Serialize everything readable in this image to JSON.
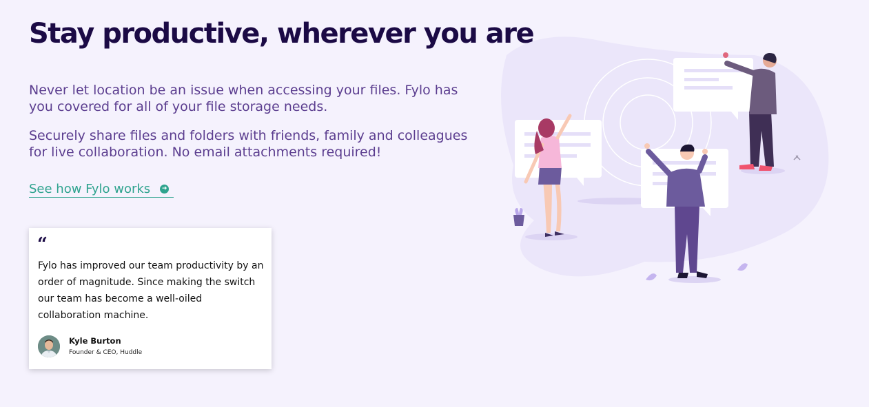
{
  "hero": {
    "title": "Stay productive, wherever you are",
    "paragraph_1": "Never let location be an issue when accessing your files. Fylo has you covered for all of your file storage needs.",
    "paragraph_2": "Securely share files and folders with friends, family and colleagues for live collaboration. No email attachments required!",
    "link_label": "See how Fylo works",
    "link_icon": "arrow-right-circle-icon"
  },
  "testimonial": {
    "quote_mark": "“",
    "quote": "Fylo has improved our team productivity by an order of magnitude. Since making the switch our team has become a well-oiled collaboration machine.",
    "author_name": "Kyle Burton",
    "author_role": "Founder & CEO, Huddle"
  },
  "colors": {
    "background": "#f5f2fd",
    "title": "#1b0a45",
    "text": "#5b3d8f",
    "accent": "#2ea38e"
  }
}
